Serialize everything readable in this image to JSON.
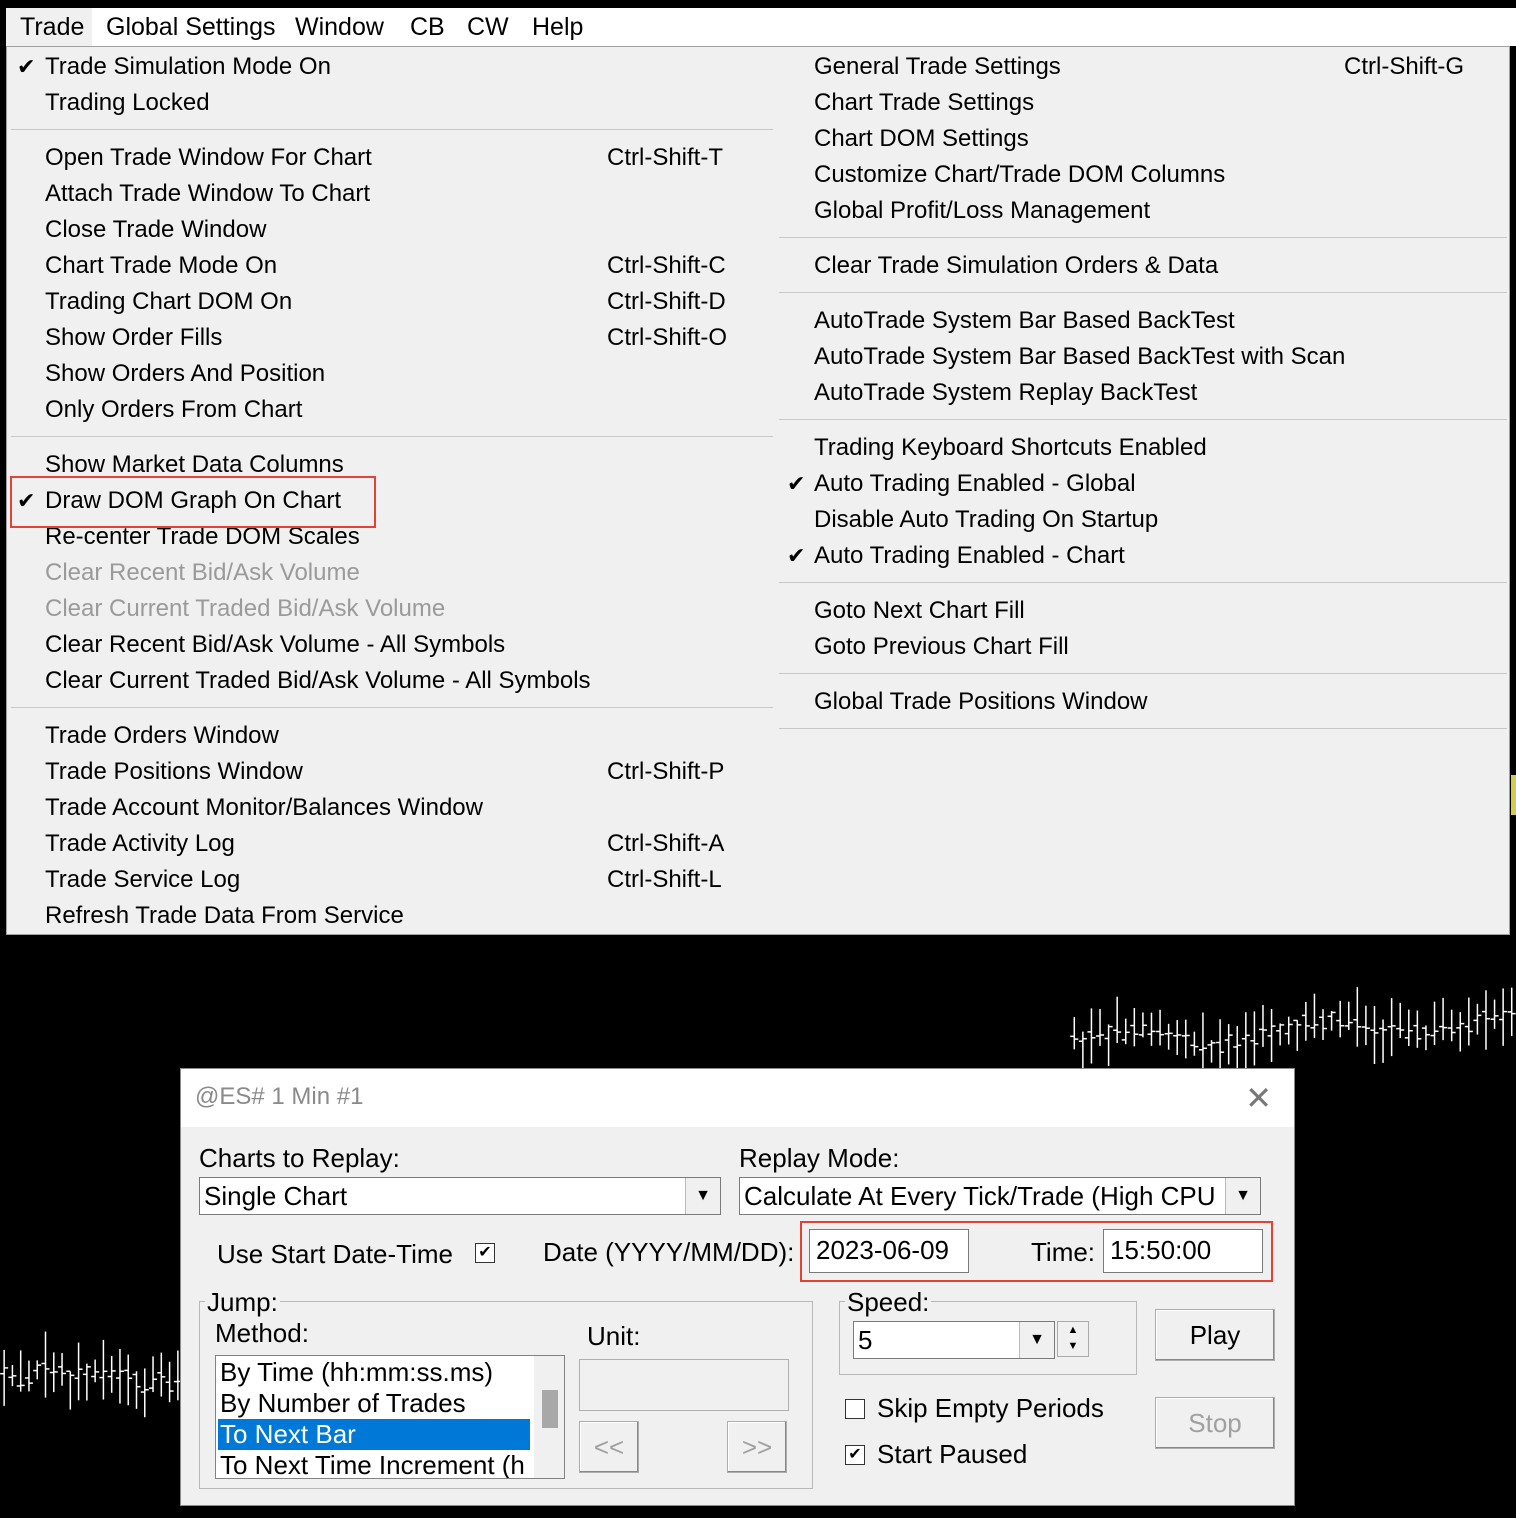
{
  "menubar": {
    "items": [
      "Trade",
      "Global Settings",
      "Window",
      "CB",
      "CW",
      "Help"
    ]
  },
  "left_column": [
    {
      "label": "Trade Simulation Mode On",
      "checked": true,
      "shortcut": ""
    },
    {
      "label": "Trading Locked",
      "checked": false,
      "shortcut": ""
    },
    {
      "label": "Open Trade Window For Chart",
      "checked": false,
      "shortcut": "Ctrl-Shift-T"
    },
    {
      "label": "Attach Trade Window To Chart",
      "checked": false,
      "shortcut": ""
    },
    {
      "label": "Close Trade Window",
      "checked": false,
      "shortcut": ""
    },
    {
      "label": "Chart Trade Mode On",
      "checked": false,
      "shortcut": "Ctrl-Shift-C"
    },
    {
      "label": "Trading Chart DOM On",
      "checked": false,
      "shortcut": "Ctrl-Shift-D"
    },
    {
      "label": "Show Order Fills",
      "checked": false,
      "shortcut": "Ctrl-Shift-O"
    },
    {
      "label": "Show Orders And Position",
      "checked": false,
      "shortcut": ""
    },
    {
      "label": "Only Orders From Chart",
      "checked": false,
      "shortcut": ""
    },
    {
      "label": "Show Market Data Columns",
      "checked": false,
      "shortcut": ""
    },
    {
      "label": "Draw DOM Graph On Chart",
      "checked": true,
      "shortcut": ""
    },
    {
      "label": "Re-center Trade DOM Scales",
      "checked": false,
      "shortcut": ""
    },
    {
      "label": "Clear Recent Bid/Ask Volume",
      "checked": false,
      "shortcut": "",
      "disabled": true
    },
    {
      "label": "Clear Current Traded Bid/Ask Volume",
      "checked": false,
      "shortcut": "",
      "disabled": true
    },
    {
      "label": "Clear Recent Bid/Ask Volume - All Symbols",
      "checked": false,
      "shortcut": ""
    },
    {
      "label": "Clear Current Traded Bid/Ask Volume - All Symbols",
      "checked": false,
      "shortcut": ""
    },
    {
      "label": "Trade Orders Window",
      "checked": false,
      "shortcut": ""
    },
    {
      "label": "Trade Positions Window",
      "checked": false,
      "shortcut": "Ctrl-Shift-P"
    },
    {
      "label": "Trade Account Monitor/Balances Window",
      "checked": false,
      "shortcut": ""
    },
    {
      "label": "Trade Activity Log",
      "checked": false,
      "shortcut": "Ctrl-Shift-A"
    },
    {
      "label": "Trade Service Log",
      "checked": false,
      "shortcut": "Ctrl-Shift-L"
    },
    {
      "label": "Refresh Trade Data From Service",
      "checked": false,
      "shortcut": ""
    }
  ],
  "right_column": [
    {
      "label": "General Trade Settings",
      "checked": false,
      "shortcut": "Ctrl-Shift-G"
    },
    {
      "label": "Chart Trade Settings",
      "checked": false,
      "shortcut": ""
    },
    {
      "label": "Chart DOM Settings",
      "checked": false,
      "shortcut": ""
    },
    {
      "label": "Customize Chart/Trade DOM Columns",
      "checked": false,
      "shortcut": ""
    },
    {
      "label": "Global Profit/Loss Management",
      "checked": false,
      "shortcut": ""
    },
    {
      "label": "Clear Trade Simulation Orders & Data",
      "checked": false,
      "shortcut": ""
    },
    {
      "label": "AutoTrade System Bar Based BackTest",
      "checked": false,
      "shortcut": ""
    },
    {
      "label": "AutoTrade System Bar Based BackTest with Scan",
      "checked": false,
      "shortcut": ""
    },
    {
      "label": "AutoTrade System Replay BackTest",
      "checked": false,
      "shortcut": ""
    },
    {
      "label": "Trading Keyboard Shortcuts Enabled",
      "checked": false,
      "shortcut": ""
    },
    {
      "label": "Auto Trading Enabled - Global",
      "checked": true,
      "shortcut": ""
    },
    {
      "label": "Disable Auto Trading On Startup",
      "checked": false,
      "shortcut": ""
    },
    {
      "label": "Auto Trading Enabled - Chart",
      "checked": true,
      "shortcut": ""
    },
    {
      "label": "Goto Next Chart Fill",
      "checked": false,
      "shortcut": ""
    },
    {
      "label": "Goto Previous Chart Fill",
      "checked": false,
      "shortcut": ""
    },
    {
      "label": "Global Trade Positions Window",
      "checked": false,
      "shortcut": ""
    }
  ],
  "dialog": {
    "title": "@ES#  1 Min  #1",
    "charts_to_replay_label": "Charts to Replay:",
    "charts_to_replay_value": "Single Chart",
    "replay_mode_label": "Replay Mode:",
    "replay_mode_value": "Calculate At Every Tick/Trade (High CPU",
    "use_start_label": "Use Start Date-Time",
    "use_start_checked": true,
    "date_label": "Date (YYYY/MM/DD):",
    "date_value": "2023-06-09",
    "time_label": "Time:",
    "time_value": "15:50:00",
    "jump_label": "Jump:",
    "method_label": "Method:",
    "methods": [
      "By Time (hh:mm:ss.ms)",
      "By Number of Trades",
      "To Next Bar",
      "To Next Time Increment (h"
    ],
    "selected_method": "To Next Bar",
    "unit_label": "Unit:",
    "prev_button": "<<",
    "next_button": ">>",
    "speed_label": "Speed:",
    "speed_value": "5",
    "play_button": "Play",
    "stop_button": "Stop",
    "skip_empty_label": "Skip Empty Periods",
    "skip_empty_checked": false,
    "start_paused_label": "Start Paused",
    "start_paused_checked": true
  }
}
